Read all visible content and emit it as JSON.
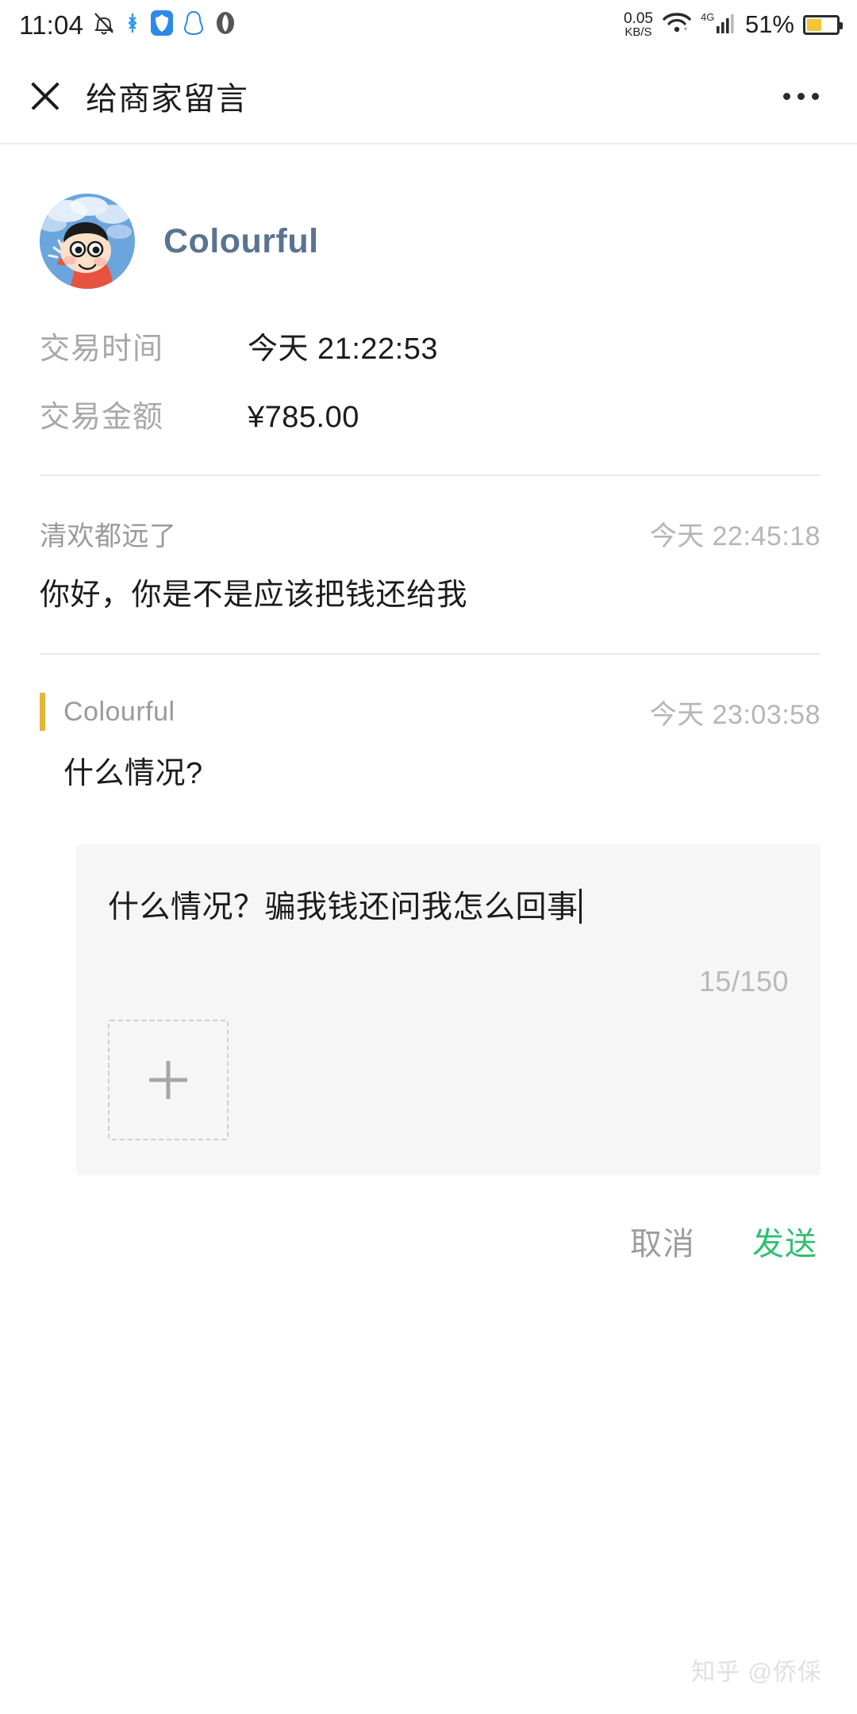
{
  "status_bar": {
    "clock": "11:04",
    "icons": [
      "bell-muted-icon",
      "bluetooth-icon",
      "shield-app-icon",
      "qq-penguin-icon",
      "browser-app-icon"
    ],
    "net_speed_value": "0.05",
    "net_speed_unit": "KB/S",
    "wifi_icon": "wifi-icon",
    "network_type": "4G",
    "signal_icon": "signal-bars-icon",
    "battery_percent": "51%",
    "battery_level": 51,
    "battery_color": "#f7c433"
  },
  "topbar": {
    "close_icon": "close-icon",
    "title": "给商家留言",
    "more_icon": "more-options-icon"
  },
  "merchant": {
    "avatar_alt": "merchant-avatar",
    "name": "Colourful",
    "name_color": "#5a7390"
  },
  "transaction": {
    "time_label": "交易时间",
    "time_value": "今天 21:22:53",
    "amount_label": "交易金额",
    "amount_value": "¥785.00"
  },
  "thread": [
    {
      "author": "清欢都远了",
      "time": "今天 22:45:18",
      "body": "你好，你是不是应该把钱还给我"
    }
  ],
  "reply": {
    "author": "Colourful",
    "time": "今天 23:03:58",
    "body": "什么情况?",
    "accent_color": "#e3b33c"
  },
  "compose": {
    "value": "什么情况？骗我钱还问我怎么回事",
    "counter": "15/150",
    "upload_icon": "add-image-icon"
  },
  "actions": {
    "cancel_label": "取消",
    "send_label": "发送",
    "send_color": "#2fbf72"
  },
  "watermark": {
    "text": "知乎 @侨倸"
  }
}
